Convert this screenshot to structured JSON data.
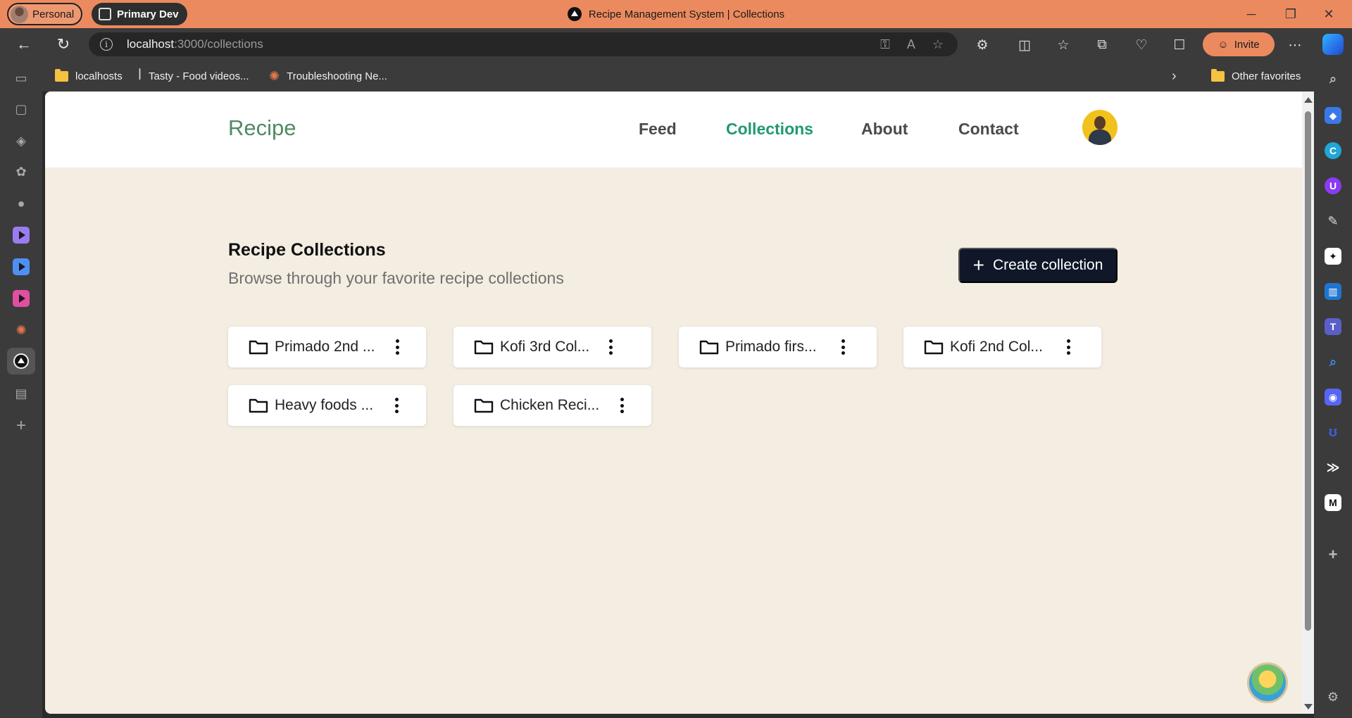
{
  "browser": {
    "profile_label": "Personal",
    "workspace_label": "Primary Dev",
    "window_title": "Recipe Management System | Collections",
    "url_host": "localhost",
    "url_path": ":3000/collections",
    "invite_label": "Invite",
    "bookmarks": [
      {
        "label": "localhosts",
        "icon": "folder-icon"
      },
      {
        "label": "Tasty - Food videos...",
        "icon": "fork-icon"
      },
      {
        "label": "Troubleshooting Ne...",
        "icon": "burst-icon"
      }
    ],
    "other_favorites_label": "Other favorites",
    "colors": {
      "titlebar": "#ec8a5f",
      "chrome": "#3b3b3b"
    }
  },
  "site": {
    "brand": "Recipe",
    "nav": [
      {
        "label": "Feed",
        "active": false
      },
      {
        "label": "Collections",
        "active": true
      },
      {
        "label": "About",
        "active": false
      },
      {
        "label": "Contact",
        "active": false
      }
    ],
    "colors": {
      "brand": "#4f8a62",
      "active_link": "#1f9a6e",
      "background": "#f4ede2",
      "button": "#0f1729"
    }
  },
  "page": {
    "title": "Recipe Collections",
    "subtitle": "Browse through your favorite recipe collections",
    "create_button": "Create collection"
  },
  "collections": [
    {
      "label": "Primado 2nd ..."
    },
    {
      "label": "Kofi 3rd Col..."
    },
    {
      "label": "Primado firs..."
    },
    {
      "label": "Kofi 2nd Col..."
    },
    {
      "label": "Heavy foods ..."
    },
    {
      "label": "Chicken Reci..."
    }
  ]
}
